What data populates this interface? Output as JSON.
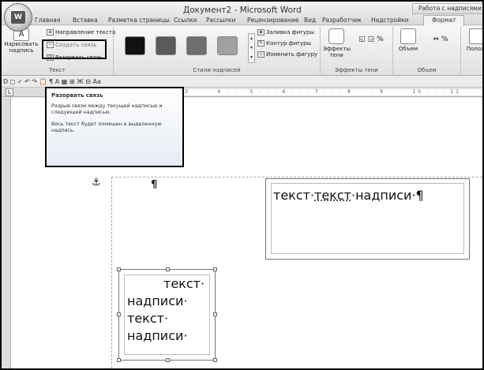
{
  "window": {
    "title": "Документ2 - Microsoft Word",
    "context_tab_header": "Работа с надписями"
  },
  "office_button": {
    "label": "W"
  },
  "tabs": [
    {
      "label": "Главная"
    },
    {
      "label": "Вставка"
    },
    {
      "label": "Разметка страницы"
    },
    {
      "label": "Ссылки"
    },
    {
      "label": "Рассылки"
    },
    {
      "label": "Рецензирование"
    },
    {
      "label": "Вид"
    },
    {
      "label": "Разработчик"
    },
    {
      "label": "Надстройки"
    },
    {
      "label": "Формат"
    }
  ],
  "ribbon": {
    "text_group": {
      "label": "Текст",
      "draw_textbox_label_1": "Нарисовать",
      "draw_textbox_label_2": "надпись",
      "direction": "Направление текста",
      "create_link": "Создать связь",
      "break_link": "Разорвать связь"
    },
    "styles_group": {
      "label": "Стили надписей",
      "swatch_colors": [
        "#111111",
        "#5a5a5a",
        "#6e6e6e",
        "#a0a0a0"
      ],
      "fill": "Заливка фигуры",
      "outline": "Контур фигуры",
      "change_shape": "Изменить фигуру"
    },
    "shadow_group": {
      "label": "Эффекты тени",
      "effects_1": "Эффекты",
      "effects_2": "тени",
      "percent": "%"
    },
    "volume_group": {
      "label": "Объем",
      "volume": "Объем",
      "percent": "%"
    },
    "position_group": {
      "label": "Полож"
    }
  },
  "toolbar": {
    "items": "D ◻ ✓ ↶ ↷ 📋 ¶ A ▦ ⊞ Ж ⊟ Aa"
  },
  "ruler": {
    "marks": "· 1 · · · 2 · · · 3 · · · 4 · · · 5 · · · 6 · · · 7 · · · 8 · · · 9 · · · 10 · · · 11"
  },
  "tooltip": {
    "title": "Разорвать связь",
    "desc1": "Разрыв связи между текущей надписью и следующей надписью.",
    "desc2": "Весь текст будет помещен в выделенную надпись."
  },
  "document": {
    "anchor": "⚓",
    "pilcrow": "¶",
    "textbox1_pre": "текст·",
    "textbox1_underlined": "текст",
    "textbox1_post": "·надписи·¶",
    "textbox2_lines": [
      "текст·",
      "надписи·",
      "текст·",
      "надписи·"
    ]
  }
}
